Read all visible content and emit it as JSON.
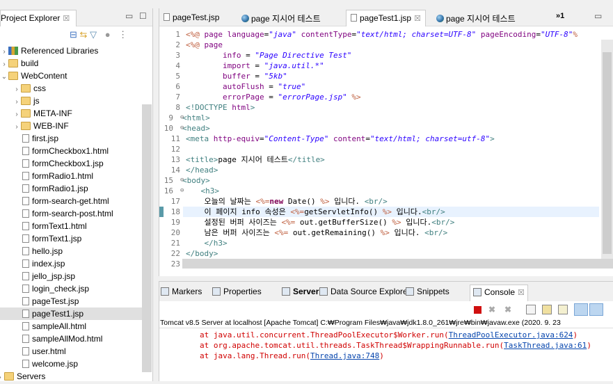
{
  "explorer": {
    "title": "Project Explorer",
    "items": [
      {
        "label": "Referenced Libraries",
        "icon": "library-icon",
        "level": 0,
        "expand": "collapsed"
      },
      {
        "label": "build",
        "icon": "folder-icon",
        "level": 0,
        "expand": "collapsed"
      },
      {
        "label": "WebContent",
        "icon": "folder-icon",
        "level": 0,
        "expand": "expanded"
      },
      {
        "label": "css",
        "icon": "folder-icon",
        "level": 1,
        "expand": "collapsed"
      },
      {
        "label": "js",
        "icon": "folder-icon",
        "level": 1,
        "expand": "collapsed"
      },
      {
        "label": "META-INF",
        "icon": "folder-icon",
        "level": 1,
        "expand": "collapsed"
      },
      {
        "label": "WEB-INF",
        "icon": "folder-icon",
        "level": 1,
        "expand": "collapsed"
      },
      {
        "label": "first.jsp",
        "icon": "jsp-file-icon",
        "level": 1
      },
      {
        "label": "formCheckbox1.html",
        "icon": "file-icon",
        "level": 1
      },
      {
        "label": "formCheckbox1.jsp",
        "icon": "file-icon",
        "level": 1
      },
      {
        "label": "formRadio1.html",
        "icon": "file-icon",
        "level": 1
      },
      {
        "label": "formRadio1.jsp",
        "icon": "file-icon",
        "level": 1
      },
      {
        "label": "form-search-get.html",
        "icon": "file-icon",
        "level": 1
      },
      {
        "label": "form-search-post.html",
        "icon": "file-icon",
        "level": 1
      },
      {
        "label": "formText1.html",
        "icon": "file-icon",
        "level": 1
      },
      {
        "label": "formText1.jsp",
        "icon": "file-icon",
        "level": 1
      },
      {
        "label": "hello.jsp",
        "icon": "file-icon",
        "level": 1
      },
      {
        "label": "index.jsp",
        "icon": "file-icon",
        "level": 1
      },
      {
        "label": "jello_jsp.jsp",
        "icon": "file-icon",
        "level": 1
      },
      {
        "label": "login_check.jsp",
        "icon": "file-icon",
        "level": 1
      },
      {
        "label": "pageTest.jsp",
        "icon": "file-icon",
        "level": 1
      },
      {
        "label": "pageTest1.jsp",
        "icon": "file-icon",
        "level": 1,
        "selected": true
      },
      {
        "label": "sampleAll.html",
        "icon": "file-icon",
        "level": 1
      },
      {
        "label": "sampleAllMod.html",
        "icon": "file-icon",
        "level": 1
      },
      {
        "label": "user.html",
        "icon": "file-icon",
        "level": 1
      },
      {
        "label": "welcome.jsp",
        "icon": "file-icon",
        "level": 1
      },
      {
        "label": "Servers",
        "icon": "folder-icon",
        "level": -1,
        "expand": "collapsed"
      }
    ]
  },
  "editor": {
    "tabs": [
      {
        "label": "pageTest.jsp",
        "icon": "jsp-file-icon"
      },
      {
        "label": "page 지시어 테스트",
        "icon": "globe-icon"
      },
      {
        "label": "pageTest1.jsp",
        "icon": "jsp-file-icon",
        "active": true
      },
      {
        "label": "page 지시어 테스트",
        "icon": "globe-icon"
      }
    ],
    "overflow": "»1",
    "lines": [
      [
        [
          "<%@",
          "d"
        ],
        [
          " page ",
          "a"
        ],
        [
          "language",
          "a"
        ],
        [
          "=",
          "p"
        ],
        [
          "\"java\"",
          "s"
        ],
        [
          " contentType",
          "a"
        ],
        [
          "=",
          "p"
        ],
        [
          "\"text/html; charset=UTF-8\"",
          "s"
        ],
        [
          " pageEncoding",
          "a"
        ],
        [
          "=",
          "p"
        ],
        [
          "\"UTF-8\"",
          "s"
        ],
        [
          "%",
          "d"
        ]
      ],
      [
        [
          "<%@",
          "d"
        ],
        [
          " page",
          "a"
        ]
      ],
      [
        [
          "        info",
          "a"
        ],
        [
          " = ",
          "p"
        ],
        [
          "\"Page Directive Test\"",
          "s"
        ]
      ],
      [
        [
          "        import",
          "a"
        ],
        [
          " = ",
          "p"
        ],
        [
          "\"java.util.*\"",
          "s"
        ]
      ],
      [
        [
          "        buffer",
          "a"
        ],
        [
          " = ",
          "p"
        ],
        [
          "\"5kb\"",
          "s"
        ]
      ],
      [
        [
          "        autoFlush",
          "a"
        ],
        [
          " = ",
          "p"
        ],
        [
          "\"true\"",
          "s"
        ]
      ],
      [
        [
          "        errorPage",
          "a"
        ],
        [
          " = ",
          "p"
        ],
        [
          "\"errorPage.jsp\"",
          "s"
        ],
        [
          " %>",
          "d"
        ]
      ],
      [
        [
          "<!DOCTYPE ",
          "g"
        ],
        [
          "html",
          "a"
        ],
        [
          ">",
          "g"
        ]
      ],
      [
        [
          "<",
          "g"
        ],
        [
          "html",
          "t"
        ],
        [
          ">",
          "g"
        ]
      ],
      [
        [
          "<",
          "g"
        ],
        [
          "head",
          "t"
        ],
        [
          ">",
          "g"
        ]
      ],
      [
        [
          "<",
          "g"
        ],
        [
          "meta",
          "t"
        ],
        [
          " http-equiv",
          "a"
        ],
        [
          "=",
          "p"
        ],
        [
          "\"Content-Type\"",
          "s"
        ],
        [
          " content",
          "a"
        ],
        [
          "=",
          "p"
        ],
        [
          "\"text/html; charset=utf-8\"",
          "s"
        ],
        [
          ">",
          "g"
        ]
      ],
      [],
      [
        [
          "<title>",
          "t"
        ],
        [
          "page 지시어 테스트",
          "p"
        ],
        [
          "</title>",
          "t"
        ]
      ],
      [
        [
          "</head>",
          "t"
        ]
      ],
      [
        [
          "<body>",
          "t"
        ]
      ],
      [
        [
          "    <h3>",
          "t"
        ]
      ],
      [
        [
          "    오늘의 날짜는 ",
          "p"
        ],
        [
          "<%=",
          "d"
        ],
        [
          "new",
          "k"
        ],
        [
          " Date() ",
          "p"
        ],
        [
          "%>",
          "d"
        ],
        [
          " 입니다. ",
          "p"
        ],
        [
          "<br/>",
          "t"
        ]
      ],
      [
        [
          "    이 페이지 info 속성은 ",
          "p"
        ],
        [
          "<%=",
          "d"
        ],
        [
          "getServletInfo() ",
          "p"
        ],
        [
          "%>",
          "d"
        ],
        [
          " 입니다.",
          "p"
        ],
        [
          "<br/>",
          "t"
        ]
      ],
      [
        [
          "    설정된 버퍼 사이즈는 ",
          "p"
        ],
        [
          "<%=",
          "d"
        ],
        [
          " out.getBufferSize() ",
          "p"
        ],
        [
          "%>",
          "d"
        ],
        [
          " 입니다.",
          "p"
        ],
        [
          "<br/>",
          "t"
        ]
      ],
      [
        [
          "    남은 버퍼 사이즈는 ",
          "p"
        ],
        [
          "<%=",
          "d"
        ],
        [
          " out.getRemaining() ",
          "p"
        ],
        [
          "%>",
          "d"
        ],
        [
          " 입니다. ",
          "p"
        ],
        [
          "<br/>",
          "t"
        ]
      ],
      [
        [
          "    </h3>",
          "t"
        ]
      ],
      [
        [
          "</body>",
          "t"
        ]
      ],
      [
        [
          "</html>",
          "t"
        ]
      ]
    ],
    "folded_lines": [
      9,
      10,
      15,
      16
    ],
    "current_line": 18
  },
  "bottom": {
    "tabs": [
      {
        "label": "Markers",
        "icon": "markers-icon"
      },
      {
        "label": "Properties",
        "icon": "properties-icon"
      },
      {
        "label": "Servers",
        "icon": "servers-icon",
        "bold": true
      },
      {
        "label": "Data Source Explorer",
        "icon": "data-source-icon"
      },
      {
        "label": "Snippets",
        "icon": "snippets-icon"
      },
      {
        "label": "Console",
        "icon": "console-icon",
        "active": true
      }
    ],
    "console_header": "Tomcat v8.5 Server at localhost [Apache Tomcat] C:₩Program Files₩java₩jdk1.8.0_261₩jre₩bin₩javaw.exe  (2020. 9. 23",
    "lines": [
      {
        "text": "at java.util.concurrent.ThreadPoolExecutor$Worker.run(",
        "link": "ThreadPoolExecutor.java:624",
        "end": ")"
      },
      {
        "text": "at org.apache.tomcat.util.threads.TaskThread$WrappingRunnable.run(",
        "link": "TaskThread.java:61",
        "end": ")"
      },
      {
        "text": "at java.lang.Thread.run(",
        "link": "Thread.java:748",
        "end": ")"
      }
    ]
  }
}
